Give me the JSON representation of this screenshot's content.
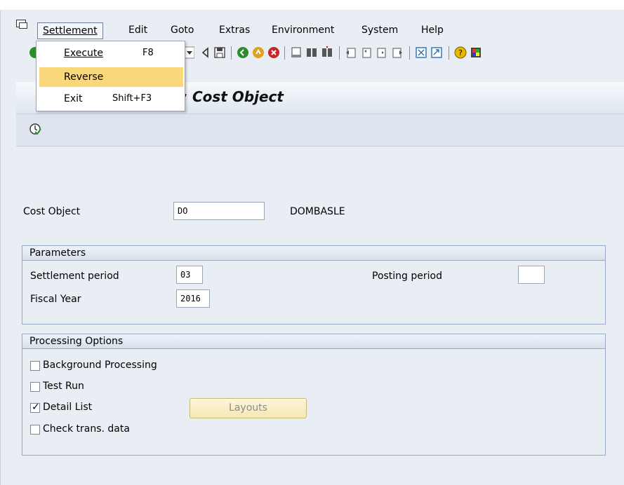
{
  "menubar": {
    "items": [
      "Settlement",
      "Edit",
      "Goto",
      "Extras",
      "Environment",
      "System",
      "Help"
    ]
  },
  "settlement_menu": {
    "items": [
      {
        "label": "Execute",
        "shortcut": "F8"
      },
      {
        "label": "Reverse",
        "shortcut": ""
      },
      {
        "label": "Exit",
        "shortcut": "Shift+F3"
      }
    ]
  },
  "title": {
    "text": ": Cost Object"
  },
  "cost_object": {
    "label": "Cost Object",
    "value": "DO",
    "description": "DOMBASLE"
  },
  "parameters": {
    "header": "Parameters",
    "settlement_period_label": "Settlement period",
    "settlement_period_value": "03",
    "posting_period_label": "Posting period",
    "posting_period_value": "",
    "fiscal_year_label": "Fiscal Year",
    "fiscal_year_value": "2016"
  },
  "processing_options": {
    "header": "Processing Options",
    "background_label": "Background Processing",
    "background_checked": false,
    "test_run_label": "Test Run",
    "test_run_checked": false,
    "detail_list_label": "Detail List",
    "detail_list_checked": true,
    "check_trans_label": "Check trans. data",
    "check_trans_checked": false,
    "layouts_button": "Layouts"
  },
  "colors": {
    "background": "#e9eef5",
    "menu_highlight": "#f8d87a",
    "group_border": "#99aac2"
  }
}
